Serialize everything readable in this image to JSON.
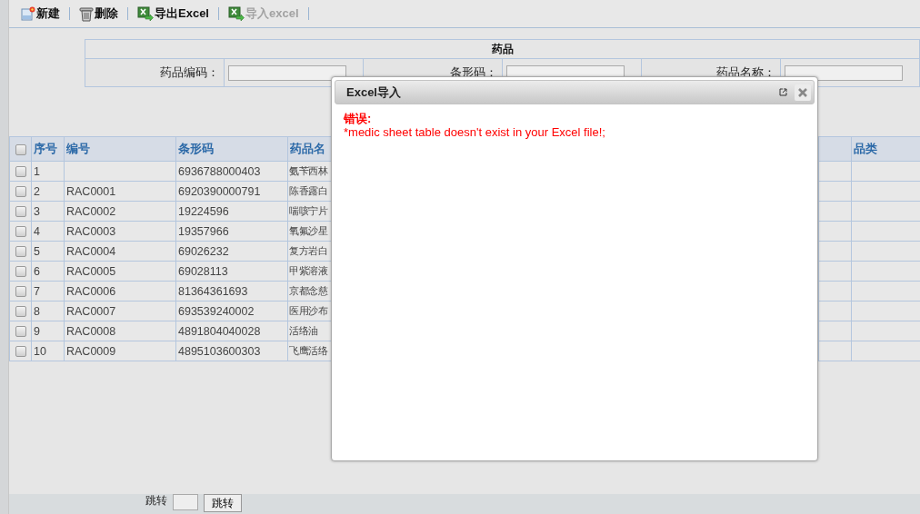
{
  "toolbar": [
    {
      "label": "新建",
      "kind": "new",
      "disabled": false
    },
    {
      "label": "删除",
      "kind": "delete",
      "disabled": false
    },
    {
      "label": "导出Excel",
      "kind": "excel",
      "disabled": false
    },
    {
      "label": "导入excel",
      "kind": "excel",
      "disabled": true
    }
  ],
  "search_form": {
    "title": "药品",
    "fields": [
      {
        "label": "药品编码："
      },
      {
        "label": "条形码："
      },
      {
        "label": "药品名称："
      }
    ]
  },
  "table": {
    "all_checked": false,
    "columns": [
      {
        "label": "序号"
      },
      {
        "label": "编号"
      },
      {
        "label": "条形码"
      },
      {
        "label": "药品名"
      },
      {},
      {
        "label": "品类"
      }
    ],
    "rows": [
      {
        "checked": false,
        "cells": [
          "1",
          "",
          "6936788000403",
          "氨苄西林"
        ]
      },
      {
        "checked": false,
        "cells": [
          "2",
          "RAC0001",
          "6920390000791",
          "陈香露白"
        ]
      },
      {
        "checked": false,
        "cells": [
          "3",
          "RAC0002",
          "19224596",
          "喘咳宁片"
        ]
      },
      {
        "checked": false,
        "cells": [
          "4",
          "RAC0003",
          "19357966",
          "氧氟沙星"
        ]
      },
      {
        "checked": false,
        "cells": [
          "5",
          "RAC0004",
          "69026232",
          "复方岩白"
        ]
      },
      {
        "checked": false,
        "cells": [
          "6",
          "RAC0005",
          "69028113",
          "甲紫溶液"
        ]
      },
      {
        "checked": false,
        "cells": [
          "7",
          "RAC0006",
          "81364361693",
          "京都念慈"
        ]
      },
      {
        "checked": false,
        "cells": [
          "8",
          "RAC0007",
          "693539240002",
          "医用沙布"
        ]
      },
      {
        "checked": false,
        "cells": [
          "9",
          "RAC0008",
          "4891804040028",
          "活络油"
        ]
      },
      {
        "checked": false,
        "cells": [
          "10",
          "RAC0009",
          "4895103600303",
          "飞鹰活络"
        ]
      }
    ]
  },
  "pager": {
    "jump_label": "跳转",
    "jump_button": "跳转"
  },
  "dialog": {
    "title": "Excel导入",
    "error_title": "错误:",
    "error_message": "*medic sheet table doesn't exist in your Excel file!;"
  }
}
